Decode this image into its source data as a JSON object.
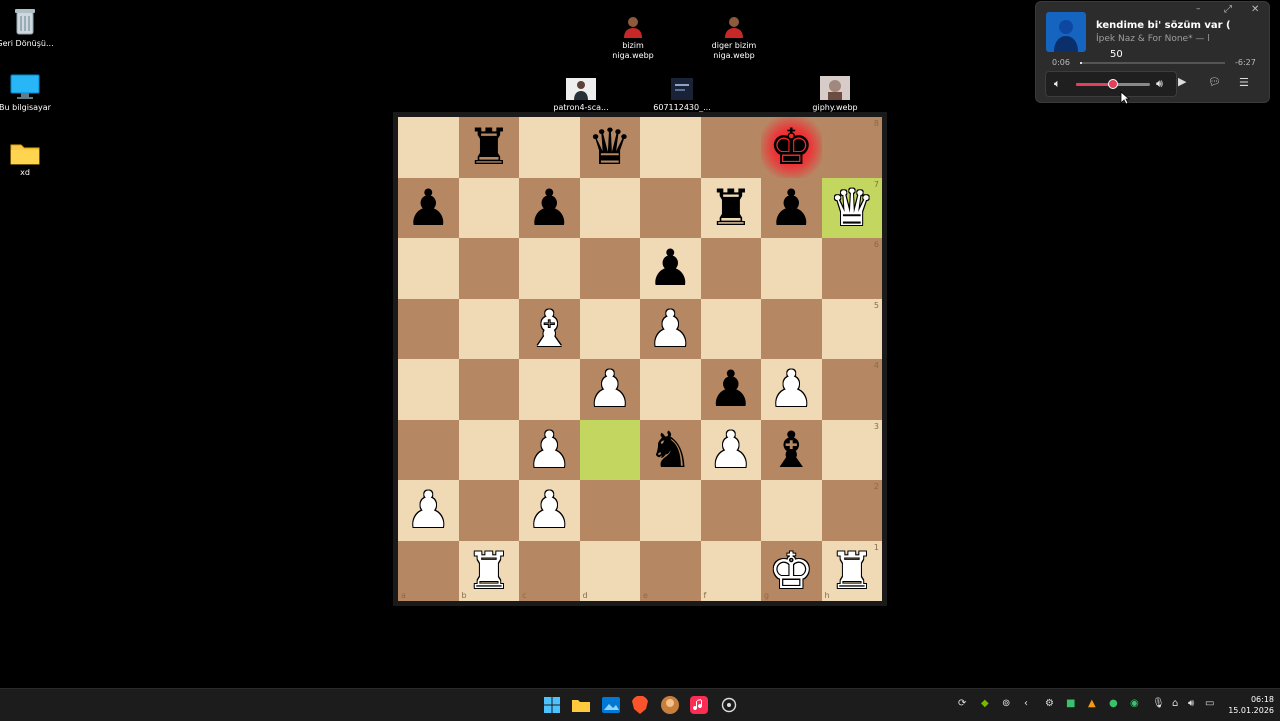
{
  "desktop": {
    "icons": [
      {
        "label": "Geri Dönüşü...",
        "icon": "recycle-bin-icon"
      },
      {
        "label": "Bu bilgisayar",
        "icon": "computer-icon"
      },
      {
        "label": "xd",
        "icon": "folder-icon"
      },
      {
        "label": "bizim niga.webp",
        "icon": "image-file-icon"
      },
      {
        "label": "diger bizim niga.webp",
        "icon": "image-file-icon"
      },
      {
        "label": "patron4-sca...",
        "icon": "image-file-icon"
      },
      {
        "label": "607112430_...",
        "icon": "image-file-icon"
      },
      {
        "label": "giphy.webp",
        "icon": "image-file-icon"
      }
    ]
  },
  "board": {
    "files": [
      "a",
      "b",
      "c",
      "d",
      "e",
      "f",
      "g",
      "h"
    ],
    "ranks": [
      "8",
      "7",
      "6",
      "5",
      "4",
      "3",
      "2",
      "1"
    ],
    "colors": {
      "light": "#f0d9b5",
      "dark": "#b58863",
      "highlight": "#c3d65f",
      "check": "#ff1010"
    },
    "rows": [
      [
        "",
        "♜",
        "",
        "♛",
        "",
        "",
        "♚",
        ""
      ],
      [
        "♟",
        "",
        "♟",
        "",
        "",
        "♜",
        "♟",
        "♛"
      ],
      [
        "",
        "",
        "",
        "",
        "♟",
        "",
        "",
        ""
      ],
      [
        "",
        "",
        "♝",
        "",
        "♟",
        "",
        "",
        ""
      ],
      [
        "",
        "",
        "",
        "♟",
        "",
        "♟",
        "♟",
        ""
      ],
      [
        "",
        "",
        "♟",
        "",
        "♞",
        "♟",
        "♝",
        ""
      ],
      [
        "♟",
        "",
        "♟",
        "",
        "",
        "",
        "",
        ""
      ],
      [
        "",
        "♜",
        "",
        "",
        "",
        "",
        "♚",
        "♜"
      ]
    ],
    "piece_colors": [
      [
        "",
        "b",
        "",
        "b",
        "",
        "",
        "b",
        ""
      ],
      [
        "b",
        "",
        "b",
        "",
        "",
        "b",
        "b",
        "w"
      ],
      [
        "",
        "",
        "",
        "",
        "b",
        "",
        "",
        ""
      ],
      [
        "",
        "",
        "w",
        "",
        "w",
        "",
        "",
        ""
      ],
      [
        "",
        "",
        "",
        "w",
        "",
        "b",
        "w",
        ""
      ],
      [
        "",
        "",
        "w",
        "",
        "b",
        "w",
        "b",
        ""
      ],
      [
        "w",
        "",
        "w",
        "",
        "",
        "",
        "",
        ""
      ],
      [
        "",
        "w",
        "",
        "",
        "",
        "",
        "w",
        "w"
      ]
    ],
    "highlighted_squares": [
      "h7",
      "d3"
    ],
    "check_square": "g8"
  },
  "media_player": {
    "title": "kendime bi' sözüm var (",
    "artist": "İpek Naz & For None* — l",
    "elapsed": "0:06",
    "remaining": "-6:27",
    "volume_label": "50",
    "volume": 50,
    "progress": 0.015,
    "accent": "#e0405a"
  },
  "taskbar": {
    "time": "06:18",
    "date": "15.01.2026"
  }
}
